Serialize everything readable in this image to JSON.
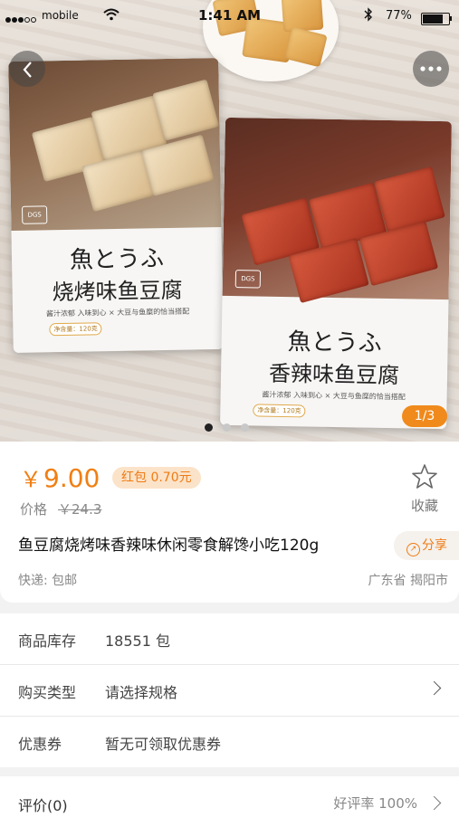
{
  "status_bar": {
    "carrier": "mobile",
    "time": "1:41 AM",
    "battery_percent": "77%",
    "battery_level": 0.77,
    "icons": [
      "signal-dots-icon",
      "wifi-icon",
      "bluetooth-icon",
      "battery-icon"
    ]
  },
  "gallery": {
    "left_bag": {
      "logo": "DGS",
      "title_jp": "魚とうふ",
      "title_cn": "烧烤味鱼豆腐",
      "tagline": "酱汁浓郁 入味到心 × 大豆与鱼糜的恰当搭配",
      "net_weight": "净含量：120克"
    },
    "right_bag": {
      "logo": "DGS",
      "title_jp": "魚とうふ",
      "title_cn": "香辣味鱼豆腐",
      "tagline": "酱汁浓郁 入味到心 × 大豆与鱼糜的恰当搭配",
      "net_weight": "净含量：120克"
    },
    "page_counter": "1/3",
    "current_page": 1,
    "total_pages": 3
  },
  "product": {
    "currency": "￥",
    "price": "9.00",
    "red_packet": "红包 0.70元",
    "original_label": "价格",
    "original_price": "￥24.3",
    "favorite_label": "收藏",
    "title": "鱼豆腐烧烤味香辣味休闲零食解馋小吃120g",
    "share_label": "分享",
    "shipping": "快递: 包邮",
    "location": "广东省 揭阳市"
  },
  "details": [
    {
      "label": "商品库存",
      "value": "18551 包"
    },
    {
      "label": "购买类型",
      "value": "请选择规格"
    },
    {
      "label": "优惠券",
      "value": "暂无可领取优惠券"
    }
  ],
  "review": {
    "label": "评价(0)",
    "rate": "好评率 100%"
  },
  "colors": {
    "accent": "#f07f13",
    "red_packet_bg": "#fbe3c9",
    "page_counter_bg": "#f08a1c"
  }
}
